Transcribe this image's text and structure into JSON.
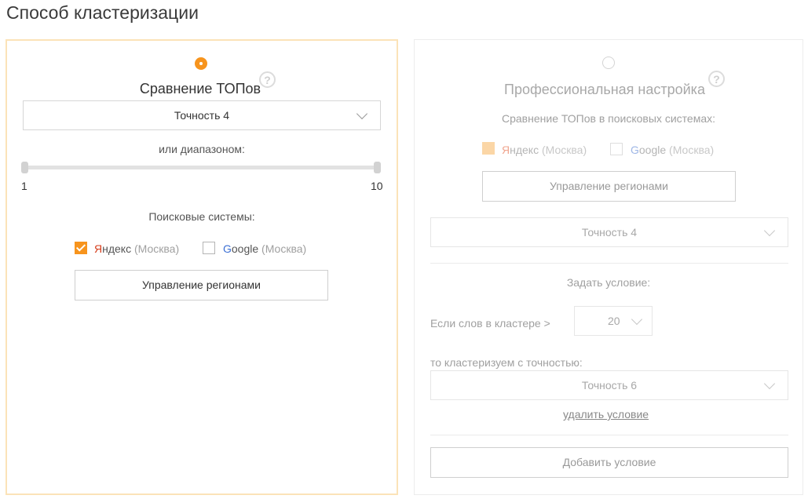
{
  "page_title": "Способ кластеризации",
  "left_panel": {
    "heading": "Сравнение ТОПов",
    "help_glyph": "?",
    "accuracy_select": "Точность 4",
    "range_label": "или диапазоном:",
    "slider_min": "1",
    "slider_max": "10",
    "search_engines_label": "Поисковые системы:",
    "yandex": {
      "first": "Я",
      "rest": "ндекс",
      "region": "(Москва)",
      "checked": true
    },
    "google": {
      "first": "G",
      "rest": "oogle",
      "region": "(Москва)",
      "checked": false
    },
    "regions_button": "Управление регионами"
  },
  "right_panel": {
    "heading": "Профессиональная настройка",
    "help_glyph": "?",
    "compare_label": "Сравнение ТОПов в поисковых системах:",
    "yandex": {
      "first": "Я",
      "rest": "ндекс",
      "region": "(Москва)",
      "checked": true
    },
    "google": {
      "first": "G",
      "rest": "oogle",
      "region": "(Москва)",
      "checked": false
    },
    "regions_button": "Управление регионами",
    "accuracy_select": "Точность 4",
    "condition_label": "Задать условие:",
    "if_words_label": "Если слов в кластере >",
    "words_count_select": "20",
    "then_label": "то кластеризуем с точностью:",
    "condition_accuracy_select": "Точность 6",
    "delete_condition_link": "удалить условие",
    "add_condition_button": "Добавить условие"
  },
  "colors": {
    "accent": "#f7941d",
    "yandex_red": "#d63c1a",
    "google_blue": "#3b6fd4",
    "panel_border_active": "#fbe3b8"
  },
  "icons": [
    "radio-selected-icon",
    "radio-unselected-icon",
    "help-icon",
    "chevron-down-icon",
    "checkbox-checked-icon",
    "checkbox-unchecked-icon"
  ]
}
